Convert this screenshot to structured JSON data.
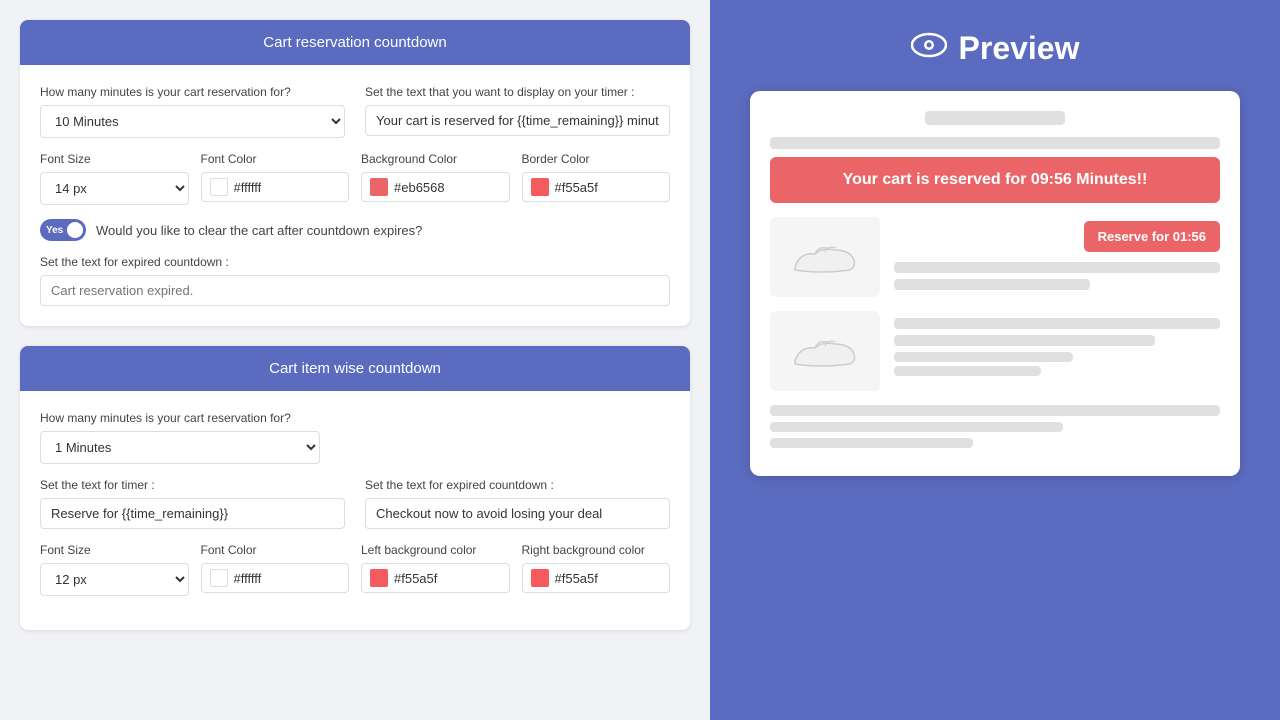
{
  "left": {
    "card1": {
      "header": "Cart reservation countdown",
      "minutesLabel": "How many minutes is your cart reservation for?",
      "minutesValue": "10 Minutes",
      "timerTextLabel": "Set the text that you want to display on your timer :",
      "timerTextValue": "Your cart is reserved for {{time_remaining}} minutes!",
      "fontSizeLabel": "Font Size",
      "fontSizeValue": "14 px",
      "fontColorLabel": "Font Color",
      "fontColorValue": "#ffffff",
      "fontColorHex": "#ffffff",
      "bgColorLabel": "Background Color",
      "bgColorValue": "#eb6568",
      "bgColorHex": "#eb6568",
      "borderColorLabel": "Border Color",
      "borderColorValue": "#f55a5f",
      "borderColorHex": "#f55a5f",
      "toggleLabel": "Would you like to clear the cart after countdown expires?",
      "toggleState": "Yes",
      "expiredLabel": "Set the text for expired countdown :",
      "expiredPlaceholder": "Cart reservation expired."
    },
    "card2": {
      "header": "Cart item wise countdown",
      "minutesLabel": "How many minutes is your cart reservation for?",
      "minutesValue": "1 Minutes",
      "timerTextLabel": "Set the text for timer :",
      "timerTextValue": "Reserve for {{time_remaining}}",
      "expiredTextLabel": "Set the text for expired countdown :",
      "expiredTextValue": "Checkout now to avoid losing your deal",
      "fontSizeLabel": "Font Size",
      "fontSizeValue": "12 px",
      "fontColorLabel": "Font Color",
      "fontColorValue": "#ffffff",
      "fontColorHex": "#ffffff",
      "leftBgColorLabel": "Left background color",
      "leftBgColorValue": "#f55a5f",
      "leftBgColorHex": "#f55a5f",
      "rightBgColorLabel": "Right background color",
      "rightBgColorValue": "#f55a5f",
      "rightBgColorHex": "#f55a5f"
    }
  },
  "right": {
    "previewTitle": "Preview",
    "eyeIcon": "👁",
    "reservationBannerText": "Your cart is reserved for 09:56 Minutes!!",
    "reserveBtnText": "Reserve for 01:56"
  },
  "colors": {
    "headerBg": "#5b6bbf",
    "reservationBannerBg": "#eb6568",
    "reserveBtnBg": "#eb6568",
    "swatchWhite": "#ffffff",
    "swatchRed1": "#eb6568",
    "swatchRed2": "#f55a5f"
  }
}
